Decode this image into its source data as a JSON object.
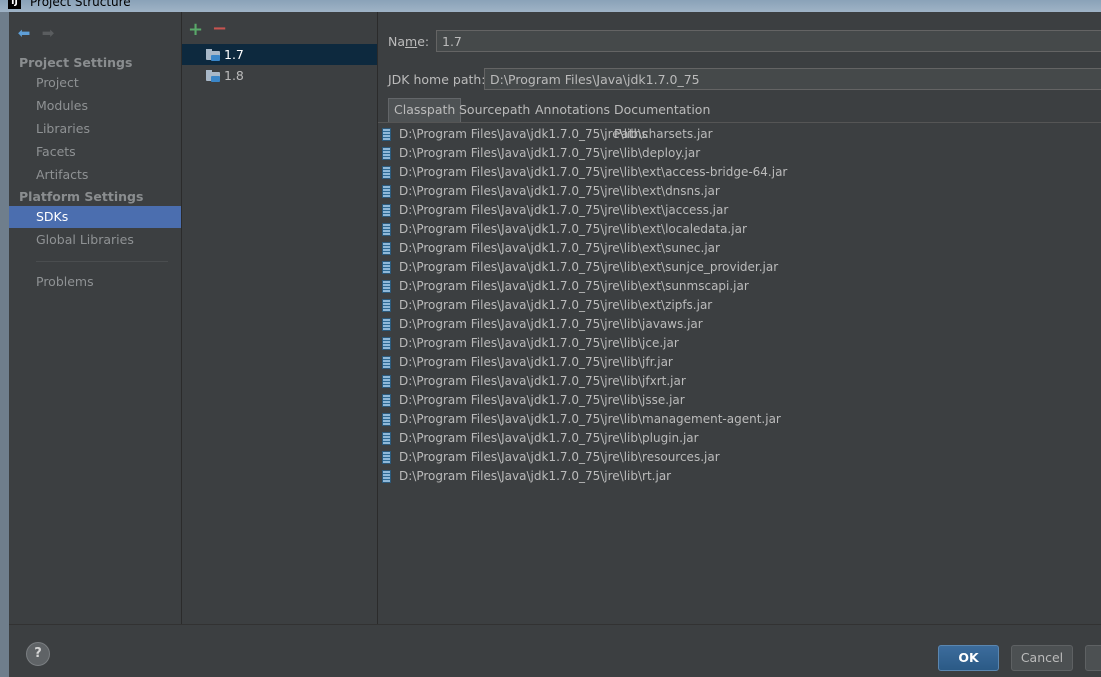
{
  "window": {
    "title": "Project Structure",
    "app_icon": "intellij-icon"
  },
  "nav": {
    "back_icon": "back-arrow-icon",
    "forward_icon": "forward-arrow-icon",
    "project_settings_header": "Project Settings",
    "project_items": [
      "Project",
      "Modules",
      "Libraries",
      "Facets",
      "Artifacts"
    ],
    "platform_settings_header": "Platform Settings",
    "platform_items": [
      "SDKs",
      "Global Libraries"
    ],
    "problems_label": "Problems",
    "selected": "SDKs"
  },
  "sdk_list": {
    "add_icon": "+",
    "remove_icon": "−",
    "items": [
      "1.7",
      "1.8"
    ],
    "selected": "1.7"
  },
  "detail": {
    "name_label_pre": "Na",
    "name_label_mnemonic": "m",
    "name_label_post": "e:",
    "name_value": "1.7",
    "jdk_home_label": "JDK home path:",
    "jdk_home_value": "D:\\Program Files\\Java\\jdk1.7.0_75",
    "tabs": [
      "Classpath",
      "Sourcepath",
      "Annotations",
      "Documentation Paths"
    ],
    "selected_tab": "Classpath",
    "classpath": [
      "D:\\Program Files\\Java\\jdk1.7.0_75\\jre\\lib\\charsets.jar",
      "D:\\Program Files\\Java\\jdk1.7.0_75\\jre\\lib\\deploy.jar",
      "D:\\Program Files\\Java\\jdk1.7.0_75\\jre\\lib\\ext\\access-bridge-64.jar",
      "D:\\Program Files\\Java\\jdk1.7.0_75\\jre\\lib\\ext\\dnsns.jar",
      "D:\\Program Files\\Java\\jdk1.7.0_75\\jre\\lib\\ext\\jaccess.jar",
      "D:\\Program Files\\Java\\jdk1.7.0_75\\jre\\lib\\ext\\localedata.jar",
      "D:\\Program Files\\Java\\jdk1.7.0_75\\jre\\lib\\ext\\sunec.jar",
      "D:\\Program Files\\Java\\jdk1.7.0_75\\jre\\lib\\ext\\sunjce_provider.jar",
      "D:\\Program Files\\Java\\jdk1.7.0_75\\jre\\lib\\ext\\sunmscapi.jar",
      "D:\\Program Files\\Java\\jdk1.7.0_75\\jre\\lib\\ext\\zipfs.jar",
      "D:\\Program Files\\Java\\jdk1.7.0_75\\jre\\lib\\javaws.jar",
      "D:\\Program Files\\Java\\jdk1.7.0_75\\jre\\lib\\jce.jar",
      "D:\\Program Files\\Java\\jdk1.7.0_75\\jre\\lib\\jfr.jar",
      "D:\\Program Files\\Java\\jdk1.7.0_75\\jre\\lib\\jfxrt.jar",
      "D:\\Program Files\\Java\\jdk1.7.0_75\\jre\\lib\\jsse.jar",
      "D:\\Program Files\\Java\\jdk1.7.0_75\\jre\\lib\\management-agent.jar",
      "D:\\Program Files\\Java\\jdk1.7.0_75\\jre\\lib\\plugin.jar",
      "D:\\Program Files\\Java\\jdk1.7.0_75\\jre\\lib\\resources.jar",
      "D:\\Program Files\\Java\\jdk1.7.0_75\\jre\\lib\\rt.jar"
    ]
  },
  "buttons": {
    "help": "?",
    "ok": "OK",
    "cancel": "Cancel"
  },
  "colors": {
    "background": "#3c3f41",
    "selection_nav": "#4b6eaf",
    "selection_list": "#0d293e",
    "add": "#59a869",
    "remove": "#c75450"
  }
}
